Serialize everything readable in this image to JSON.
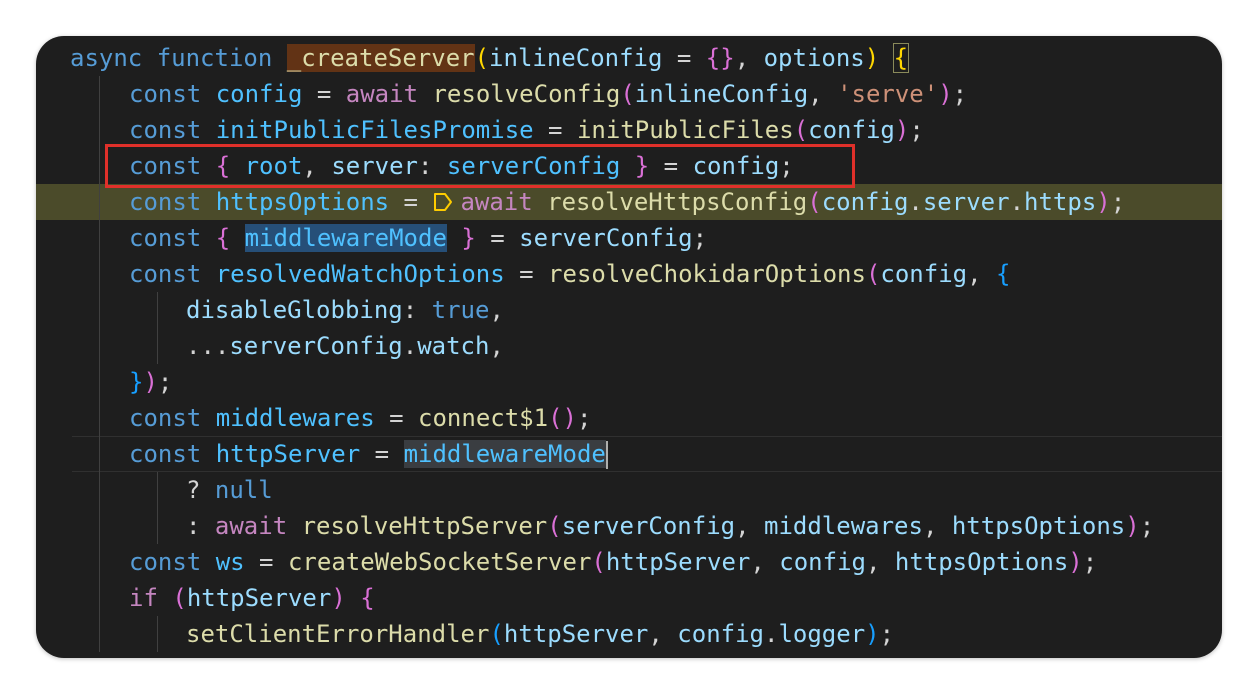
{
  "editor": {
    "colors": {
      "background": "#1e1e1e",
      "debug_line": "#4b4b2a",
      "annotation_box": "#e0302a"
    },
    "lines": {
      "l1": {
        "kw": "async",
        "kw2": "function",
        "fn": "_createServer",
        "p1": "inlineConfig",
        "eq": " = ",
        "obj": "{}",
        "comma": ", ",
        "p2": "options",
        "close": ")",
        "brace": "{"
      },
      "l2": {
        "kw": "const",
        "name": "config",
        "eq": " = ",
        "aw": "await",
        "fn": "resolveConfig",
        "arg1": "inlineConfig",
        "comma": ", ",
        "str": "'serve'",
        "end": ");"
      },
      "l3": {
        "kw": "const",
        "name": "initPublicFilesPromise",
        "eq": " = ",
        "fn": "initPublicFiles",
        "arg": "config",
        "end": ");"
      },
      "l4": {
        "kw": "const",
        "lb": "{",
        "a": "root",
        "comma": ", ",
        "b": "server",
        "colon": ": ",
        "c": "serverConfig",
        "rb": "}",
        "eq": " = ",
        "src": "config",
        "semi": ";"
      },
      "l5": {
        "kw": "const",
        "name": "httpsOptions",
        "eq": " = ",
        "aw": "await",
        "fn": "resolveHttpsConfig",
        "a": "config",
        "dot1": ".",
        "b": "server",
        "dot2": ".",
        "c": "https",
        "end": ");"
      },
      "l6": {
        "kw": "const",
        "lb": "{",
        "a": "middlewareMode",
        "rb": "}",
        "eq": " = ",
        "src": "serverConfig",
        "semi": ";"
      },
      "l7": {
        "kw": "const",
        "name": "resolvedWatchOptions",
        "eq": " = ",
        "fn": "resolveChokidarOptions",
        "arg": "config",
        "comma": ", ",
        "brace": "{"
      },
      "l8": {
        "key": "disableGlobbing",
        "colon": ": ",
        "val": "true",
        "comma": ","
      },
      "l9": {
        "spread": "...",
        "a": "serverConfig",
        "dot": ".",
        "b": "watch",
        "comma": ","
      },
      "l10": {
        "rb": "}",
        "rp": ")",
        "semi": ";"
      },
      "l11": {
        "kw": "const",
        "name": "middlewares",
        "eq": " = ",
        "fn": "connect$1",
        "parens": "()",
        "semi": ";"
      },
      "l12": {
        "kw": "const",
        "name": "httpServer",
        "eq": " = ",
        "val": "middlewareMode"
      },
      "l13": {
        "q": "? ",
        "val": "null"
      },
      "l14": {
        "colon": ": ",
        "aw": "await",
        "fn": "resolveHttpServer",
        "a": "serverConfig",
        "c1": ", ",
        "b": "middlewares",
        "c2": ", ",
        "c": "httpsOptions",
        "end": ");"
      },
      "l15": {
        "kw": "const",
        "name": "ws",
        "eq": " = ",
        "fn": "createWebSocketServer",
        "a": "httpServer",
        "c1": ", ",
        "b": "config",
        "c2": ", ",
        "c": "httpsOptions",
        "end": ");"
      },
      "l16": {
        "kw": "if",
        "lp": "(",
        "a": "httpServer",
        "rp": ")",
        "brace": "{"
      },
      "l17": {
        "fn": "setClientErrorHandler",
        "a": "httpServer",
        "comma": ", ",
        "b": "config",
        "dot": ".",
        "c": "logger",
        "end": ");"
      }
    }
  }
}
